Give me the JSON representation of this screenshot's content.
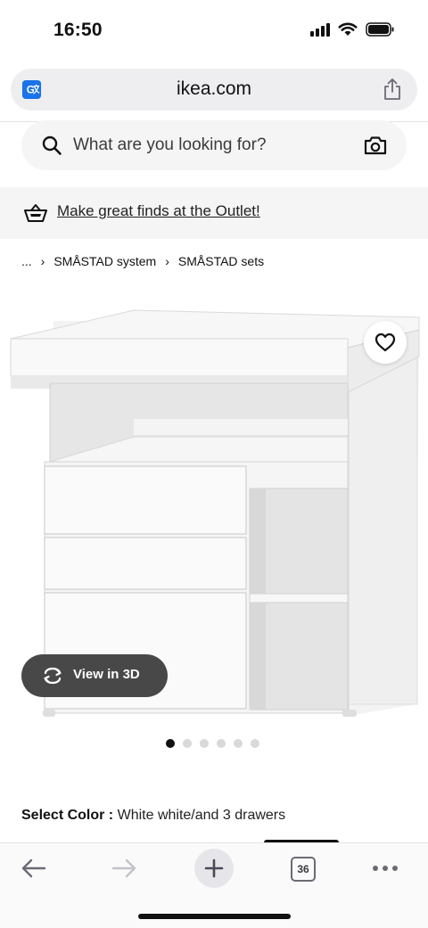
{
  "status_bar": {
    "time": "16:50"
  },
  "browser": {
    "url": "ikea.com",
    "tab_count": "36"
  },
  "search": {
    "placeholder": "What are you looking for?"
  },
  "outlet_banner": {
    "text": "Make great finds at the Outlet!"
  },
  "breadcrumb": {
    "items": [
      {
        "label": "..."
      },
      {
        "label": "SMÅSTAD system"
      },
      {
        "label": "SMÅSTAD sets"
      }
    ],
    "separator": "›"
  },
  "product": {
    "view_3d_label": "View in 3D",
    "image_count": 6,
    "active_image": 1
  },
  "color_selection": {
    "label": "Select Color :",
    "value": "White white/and 3 drawers"
  },
  "icons": {
    "translate": "translate-icon",
    "share": "share-icon",
    "search": "search-icon",
    "camera": "camera-icon",
    "basket": "basket-icon",
    "favorite": "heart-icon",
    "view3d": "rotate-3d-icon",
    "back": "arrow-left-icon",
    "forward": "arrow-right-icon",
    "new_tab": "plus-icon",
    "more": "more-icon"
  },
  "colors": {
    "accent_blue": "#1a73e8",
    "dark_pill": "#484848",
    "banner_bg": "#f5f5f5"
  }
}
